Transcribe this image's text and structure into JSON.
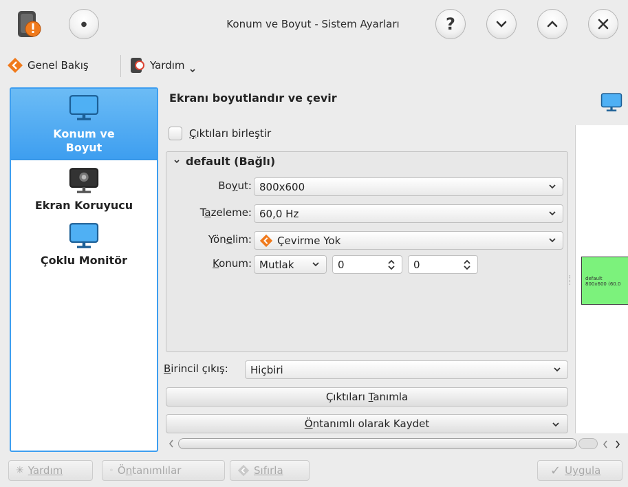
{
  "window": {
    "title": "Konum ve Boyut - Sistem Ayarları"
  },
  "toolbar": {
    "overview_label": "Genel Bakış",
    "help_label": "Yardım"
  },
  "sidebar": {
    "items": [
      {
        "label": "Konum ve Boyut",
        "active": true
      },
      {
        "label": "Ekran Koruyucu",
        "active": false
      },
      {
        "label": "Çoklu Monitör",
        "active": false
      }
    ]
  },
  "main": {
    "heading": "Ekranı boyutlandır ve çevir",
    "merge_outputs_prefix": "Ç",
    "merge_outputs_rest": "ıktıları birleştir",
    "output_group_title": "default (Bağlı)",
    "size": {
      "label_pre": "Bo",
      "label_u": "y",
      "label_post": "ut:",
      "value": "800x600"
    },
    "refresh": {
      "label_pre": "T",
      "label_u": "a",
      "label_post": "zeleme:",
      "value": "60,0 Hz"
    },
    "orientation": {
      "label_pre": "Yön",
      "label_u": "e",
      "label_post": "lim:",
      "value": "Çevirme Yok"
    },
    "position": {
      "label_u": "K",
      "label_post": "onum:",
      "mode": "Mutlak",
      "x": "0",
      "y": "0"
    },
    "primary_output": {
      "label_u": "B",
      "label_post": "irincil çıkış:",
      "value": "Hiçbiri"
    },
    "identify_pre": "Çıktıları ",
    "identify_u": "T",
    "identify_post": "anımla",
    "save_default_u": "Ö",
    "save_default_post": "ntanımlı olarak Kaydet"
  },
  "preview": {
    "output_name": "default",
    "output_info": "800x600 (60.0"
  },
  "bottom": {
    "help_label": "Yardım",
    "defaults_pre": "Ö",
    "defaults_u": "n",
    "defaults_post": "tanımlılar",
    "reset_label": "Sıfırla",
    "apply_label": "Uygula"
  },
  "colors": {
    "accent": "#3d9ef0",
    "preview_output": "#7cf27c"
  }
}
